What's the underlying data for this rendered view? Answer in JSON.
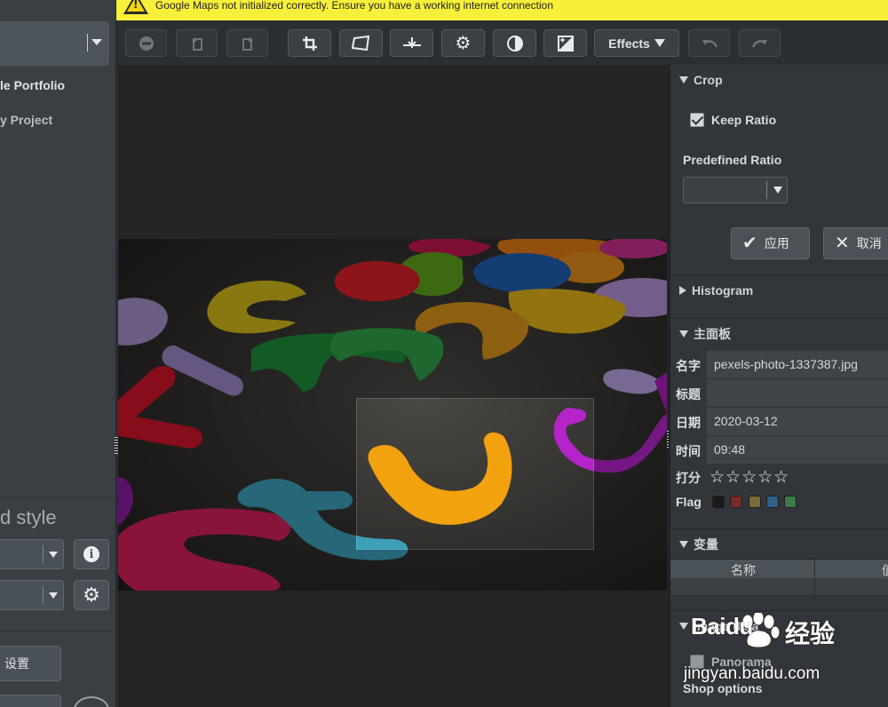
{
  "warning": {
    "text": "Google Maps not initialized correctly. Ensure you have a working internet connection"
  },
  "left_panel": {
    "projects": [
      "le Portfolio",
      "y Project"
    ],
    "style_label": "d style",
    "settings_button": "设置",
    "info_glyph": "i"
  },
  "toolbar": {
    "effects_label": "Effects",
    "icons": [
      "reject-icon",
      "rotate-left-icon",
      "rotate-right-icon",
      "crop-icon",
      "perspective-icon",
      "straighten-icon",
      "gear-icon",
      "contrast-icon",
      "exposure-icon",
      "undo-icon",
      "redo-icon"
    ]
  },
  "right_panel": {
    "crop": {
      "title": "Crop",
      "keep_ratio_label": "Keep Ratio",
      "keep_ratio_checked": true,
      "predefined_ratio_label": "Predefined Ratio",
      "predefined_ratio_value": "",
      "apply_label": "应用",
      "cancel_label": "取消"
    },
    "histogram_title": "Histogram",
    "main_panel": {
      "title": "主面板",
      "rows": [
        {
          "key": "名字",
          "value": "pexels-photo-1337387.jpg"
        },
        {
          "key": "标题",
          "value": ""
        },
        {
          "key": "日期",
          "value": "2020-03-12"
        },
        {
          "key": "时间",
          "value": "09:48"
        }
      ],
      "rating_label": "打分",
      "rating_stars": "☆☆☆☆☆",
      "flag_label": "Flag",
      "flag_colors": [
        "#1a1a1a",
        "#7a2a2a",
        "#7a6a3a",
        "#2f5f8a",
        "#3b7a4a"
      ]
    },
    "variables": {
      "title": "变量",
      "columns": [
        "名称",
        "值"
      ]
    },
    "image_data_title": "Image data",
    "panorama_label": "Panorama",
    "shop_options_title": "Shop options"
  },
  "watermark": {
    "brand": "Baidu",
    "brand_cn": "经验",
    "url": "jingyan.baidu.com"
  },
  "colors": {
    "warning_bg": "#f7f03a",
    "panel_bg": "#32363a",
    "viewer_bg": "#252525"
  }
}
